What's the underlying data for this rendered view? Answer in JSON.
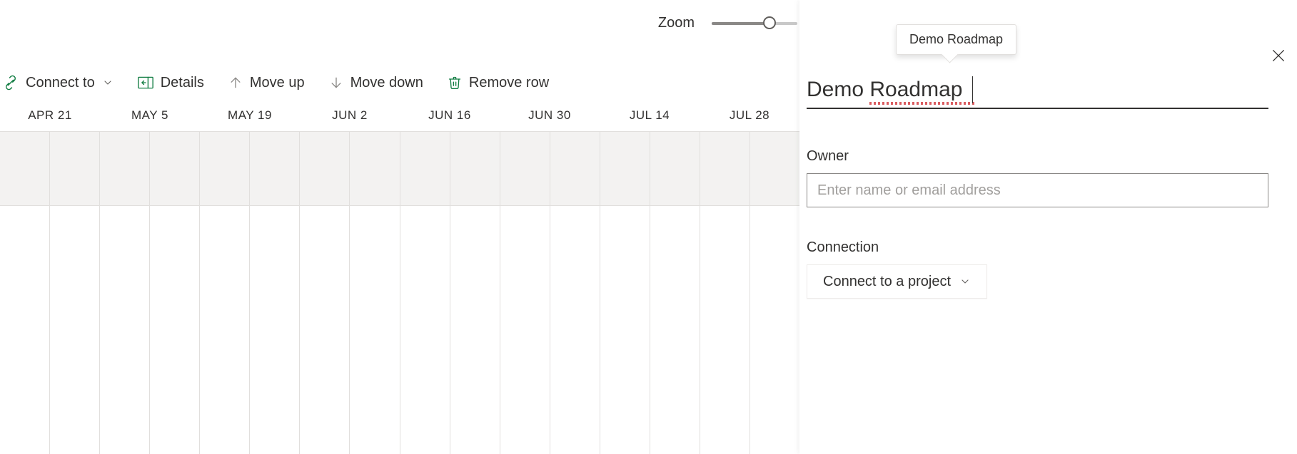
{
  "zoom": {
    "label": "Zoom"
  },
  "toolbar": {
    "connect_to": "Connect to",
    "details": "Details",
    "move_up": "Move up",
    "move_down": "Move down",
    "remove_row": "Remove row"
  },
  "timeline": {
    "columns": [
      "APR 21",
      "MAY 5",
      "MAY 19",
      "JUN 2",
      "JUN 16",
      "JUN 30",
      "JUL 14",
      "JUL 28"
    ]
  },
  "panel": {
    "tooltip_title": "Demo Roadmap",
    "title_value": "Demo Roadmap",
    "owner_label": "Owner",
    "owner_placeholder": "Enter name or email address",
    "connection_label": "Connection",
    "connect_button": "Connect to a project"
  },
  "colors": {
    "icon_green": "#107c41",
    "icon_gray": "#8a8886"
  }
}
